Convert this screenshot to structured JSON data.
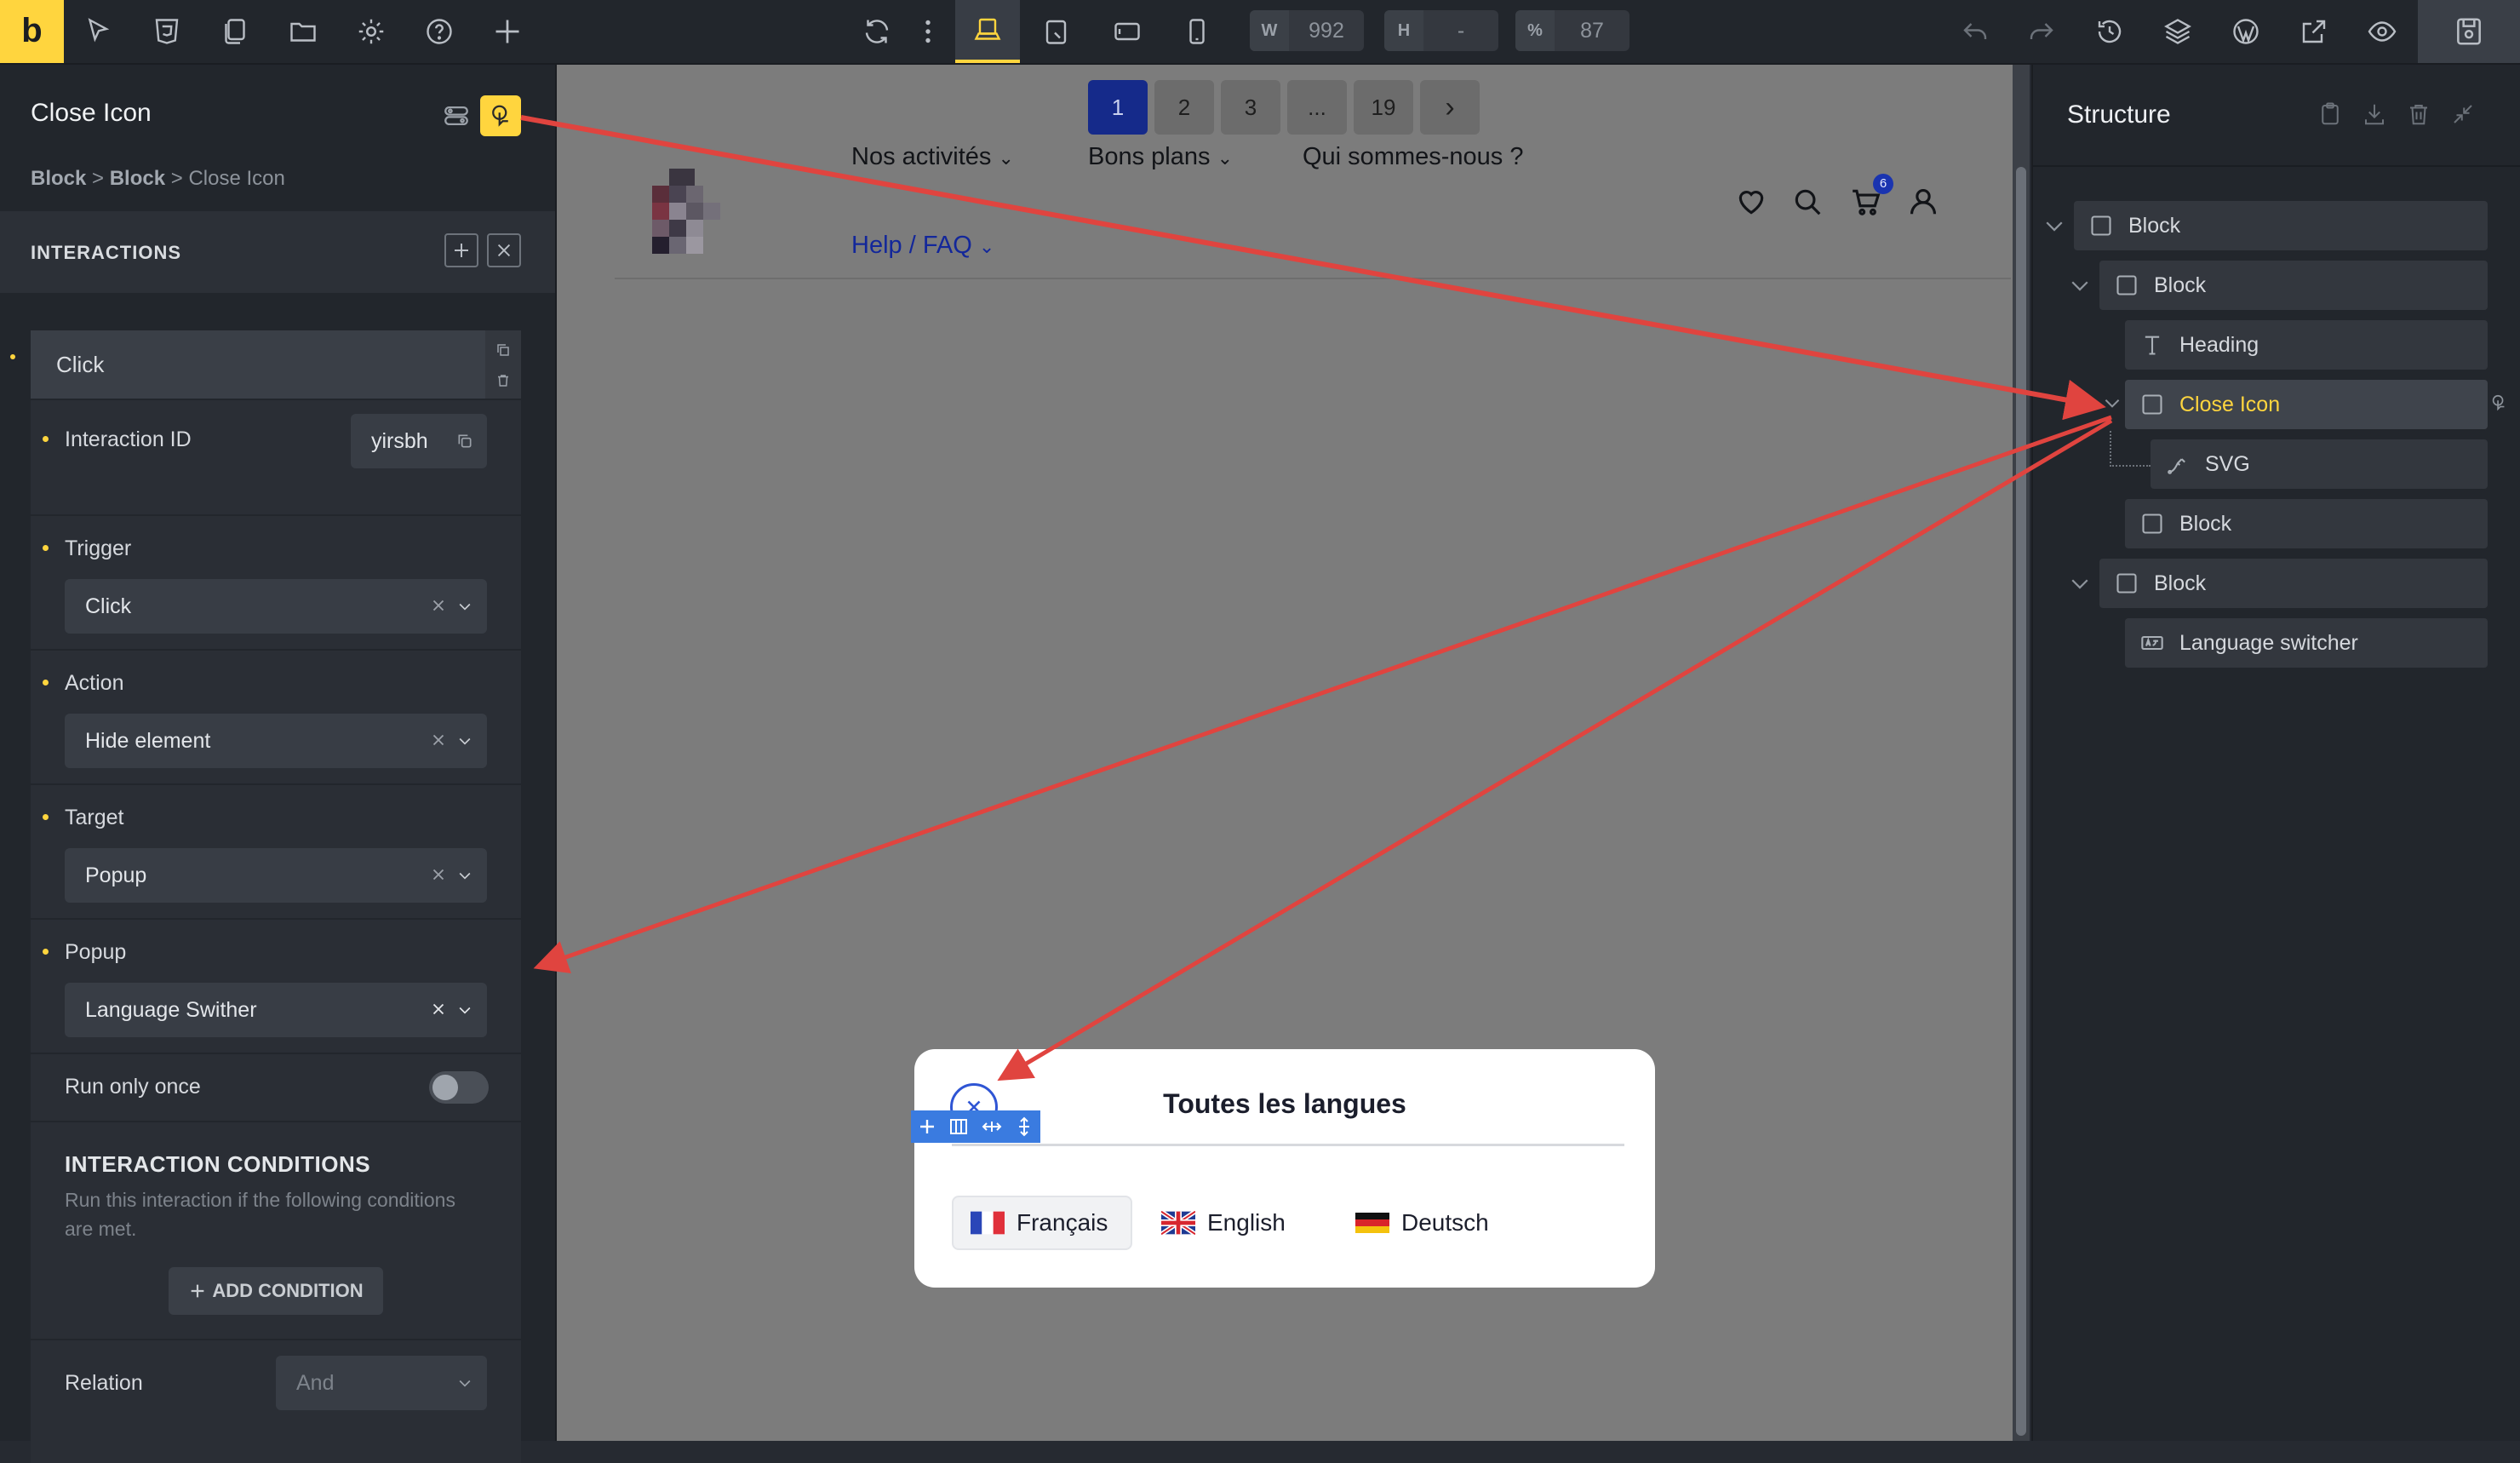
{
  "toolbar": {
    "logo": "b",
    "width_label": "W",
    "width_value": "992",
    "height_label": "H",
    "height_value": "-",
    "zoom_label": "%",
    "zoom_value": "87"
  },
  "left_panel": {
    "title": "Close Icon",
    "breadcrumb": {
      "part1": "Block",
      "sep1": ">",
      "part2": "Block",
      "sep2": ">",
      "current": "Close Icon"
    },
    "section_title": "INTERACTIONS",
    "interaction": {
      "name": "Click",
      "id_label": "Interaction ID",
      "id_value": "yirsbh",
      "trigger_label": "Trigger",
      "trigger_value": "Click",
      "action_label": "Action",
      "action_value": "Hide element",
      "target_label": "Target",
      "target_value": "Popup",
      "popup_label": "Popup",
      "popup_value": "Language Swither",
      "run_once_label": "Run only once",
      "conditions_title": "INTERACTION CONDITIONS",
      "conditions_desc": "Run this interaction if the following conditions are met.",
      "add_condition": "ADD CONDITION",
      "relation_label": "Relation",
      "relation_value": "And"
    }
  },
  "canvas": {
    "pagination": [
      "1",
      "2",
      "3",
      "...",
      "19"
    ],
    "pagination_next": "›",
    "nav": {
      "item1": "Nos activités",
      "item2": "Bons plans",
      "item3": "Qui sommes-nous ?",
      "item4": "Help / FAQ"
    },
    "cart_count": "6",
    "popup": {
      "title": "Toutes les langues",
      "languages": [
        "Français",
        "English",
        "Deutsch"
      ]
    }
  },
  "structure": {
    "title": "Structure",
    "nodes": [
      {
        "label": "Block"
      },
      {
        "label": "Block"
      },
      {
        "label": "Heading"
      },
      {
        "label": "Close Icon"
      },
      {
        "label": "SVG"
      },
      {
        "label": "Block"
      },
      {
        "label": "Block"
      },
      {
        "label": "Language switcher"
      }
    ]
  },
  "colors": {
    "accent": "#ffd53e",
    "arrow": "#e0443f",
    "popup_close": "#2f55d4",
    "pagination_active": "#152a8a"
  }
}
